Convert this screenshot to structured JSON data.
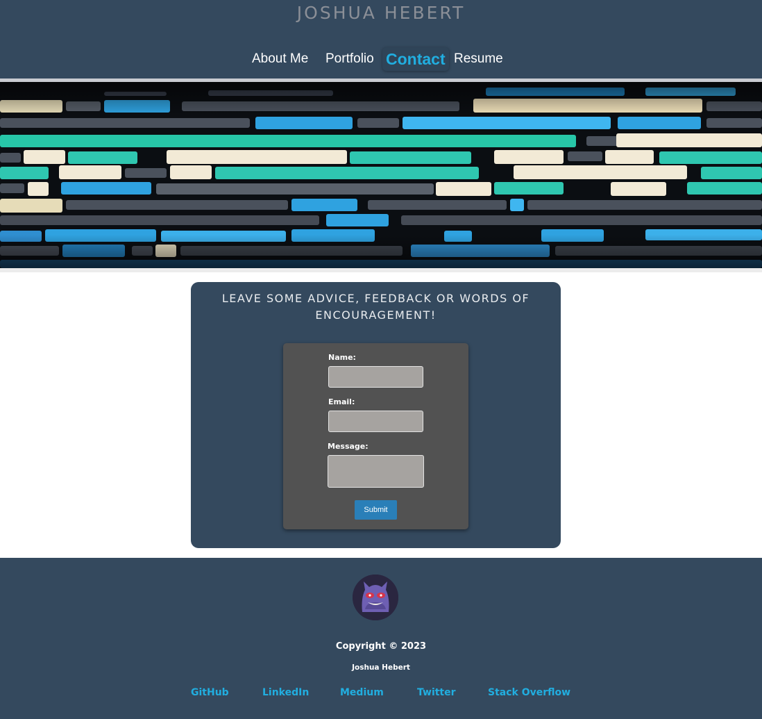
{
  "site": {
    "title": "JOSHUA HEBERT"
  },
  "nav": {
    "items": [
      {
        "label": "About Me",
        "active": false
      },
      {
        "label": "Portfolio",
        "active": false
      },
      {
        "label": "Contact",
        "active": true
      },
      {
        "label": "Resume",
        "active": false
      }
    ]
  },
  "contact": {
    "heading": "LEAVE SOME ADVICE, FEEDBACK OR WORDS OF ENCOURAGEMENT!",
    "name_label": "Name:",
    "name_value": "",
    "email_label": "Email:",
    "email_value": "",
    "message_label": "Message:",
    "message_value": "",
    "submit_label": "Submit"
  },
  "footer": {
    "avatar_icon": "gengar-avatar",
    "copyright": "Copyright © 2023",
    "author": "Joshua Hebert",
    "links": [
      "GitHub",
      "LinkedIn",
      "Medium",
      "Twitter",
      "Stack Overflow"
    ]
  },
  "colors": {
    "header_bg": "#34495e",
    "accent": "#21aee0",
    "form_bg": "#525252",
    "input_bg": "#a6a3a0",
    "button_bg": "#2a7fb8"
  }
}
